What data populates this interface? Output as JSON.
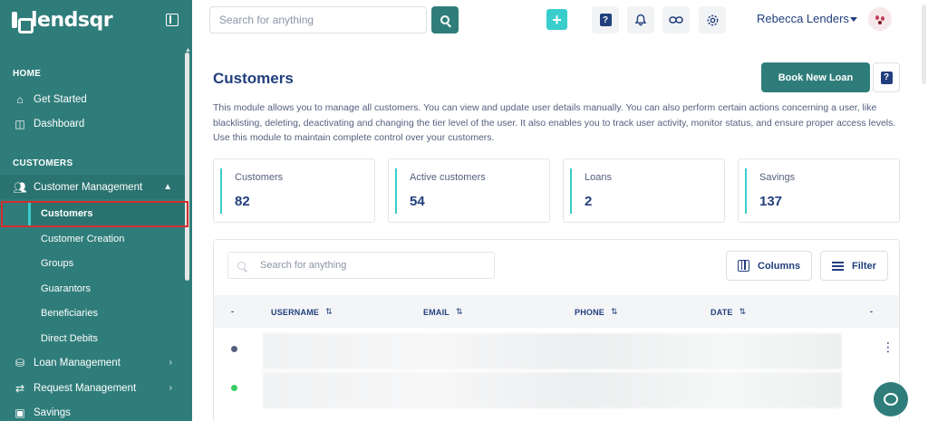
{
  "app": {
    "logo_text": "lendsqr"
  },
  "sidebar": {
    "sections": [
      {
        "heading": "HOME"
      },
      {
        "heading": "CUSTOMERS"
      }
    ],
    "home_items": [
      {
        "label": "Get Started",
        "icon": "home-icon"
      },
      {
        "label": "Dashboard",
        "icon": "dashboard-icon"
      }
    ],
    "customer_group": {
      "label": "Customer Management",
      "icon": "users-icon",
      "expanded": true
    },
    "customer_sub_items": [
      {
        "label": "Customers",
        "active": true
      },
      {
        "label": "Customer Creation"
      },
      {
        "label": "Groups"
      },
      {
        "label": "Guarantors"
      },
      {
        "label": "Beneficiaries"
      },
      {
        "label": "Direct Debits"
      }
    ],
    "more_items": [
      {
        "label": "Loan Management",
        "icon": "loan-icon"
      },
      {
        "label": "Request Management",
        "icon": "request-icon"
      },
      {
        "label": "Savings",
        "icon": "savings-icon"
      }
    ]
  },
  "topbar": {
    "search_placeholder": "Search for anything",
    "user_name": "Rebecca Lenders",
    "icons": [
      "plus-icon",
      "help-icon",
      "bell-icon",
      "link-icon",
      "gear-icon"
    ]
  },
  "page": {
    "title": "Customers",
    "book_button": "Book New Loan",
    "description": "This module allows you to manage all customers. You can view and update user details manually. You can also perform certain actions concerning a user, like blacklisting, deleting, deactivating and changing the tier level of the user. It also enables you to track user activity, monitor status, and ensure proper access levels. Use this module to maintain complete control over your customers."
  },
  "stats": [
    {
      "label": "Customers",
      "value": "82"
    },
    {
      "label": "Active customers",
      "value": "54"
    },
    {
      "label": "Loans",
      "value": "2"
    },
    {
      "label": "Savings",
      "value": "137"
    }
  ],
  "table": {
    "search_placeholder": "Search for anything",
    "columns_button": "Columns",
    "filter_button": "Filter",
    "headers": {
      "status": "-",
      "username": "USERNAME",
      "email": "EMAIL",
      "phone": "PHONE",
      "date": "DATE",
      "actions": "-"
    },
    "rows": [
      {
        "status_color": "#545F7D"
      },
      {
        "status_color": "#39CD62"
      }
    ]
  },
  "colors": {
    "primary": "#2f7d7a",
    "accent": "#39CDCC",
    "text": "#213F7D",
    "highlight": "#d42d2d"
  }
}
